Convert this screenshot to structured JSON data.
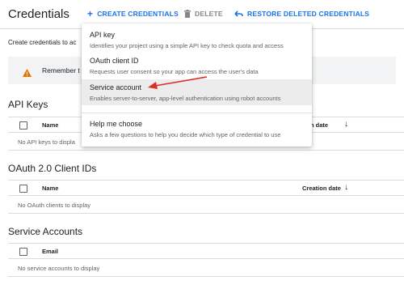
{
  "header": {
    "title": "Credentials",
    "create_label": "CREATE CREDENTIALS",
    "delete_label": "DELETE",
    "restore_label": "RESTORE DELETED CREDENTIALS"
  },
  "intro_text": "Create credentials to ac",
  "notice_text": "Remember t",
  "sections": {
    "api_keys": {
      "title": "API Keys",
      "col_name": "Name",
      "col_date": "n date",
      "empty": "No API keys to displa"
    },
    "oauth": {
      "title": "OAuth 2.0 Client IDs",
      "col_name": "Name",
      "col_date": "Creation date",
      "empty": "No OAuth clients to display"
    },
    "service": {
      "title": "Service Accounts",
      "col_name": "Email",
      "empty": "No service accounts to display"
    }
  },
  "menu": {
    "items": [
      {
        "title": "API key",
        "desc": "Identifies your project using a simple API key to check quota and access"
      },
      {
        "title": "OAuth client ID",
        "desc": "Requests user consent so your app can access the user's data"
      },
      {
        "title": "Service account",
        "desc": "Enables server-to-server, app-level authentication using robot accounts"
      },
      {
        "title": "Help me choose",
        "desc": "Asks a few questions to help you decide which type of credential to use"
      }
    ]
  },
  "colors": {
    "accent": "#1a73e8",
    "warning": "#e37400",
    "pointer_arrow": "#d93025",
    "highlight": "#ececec"
  }
}
